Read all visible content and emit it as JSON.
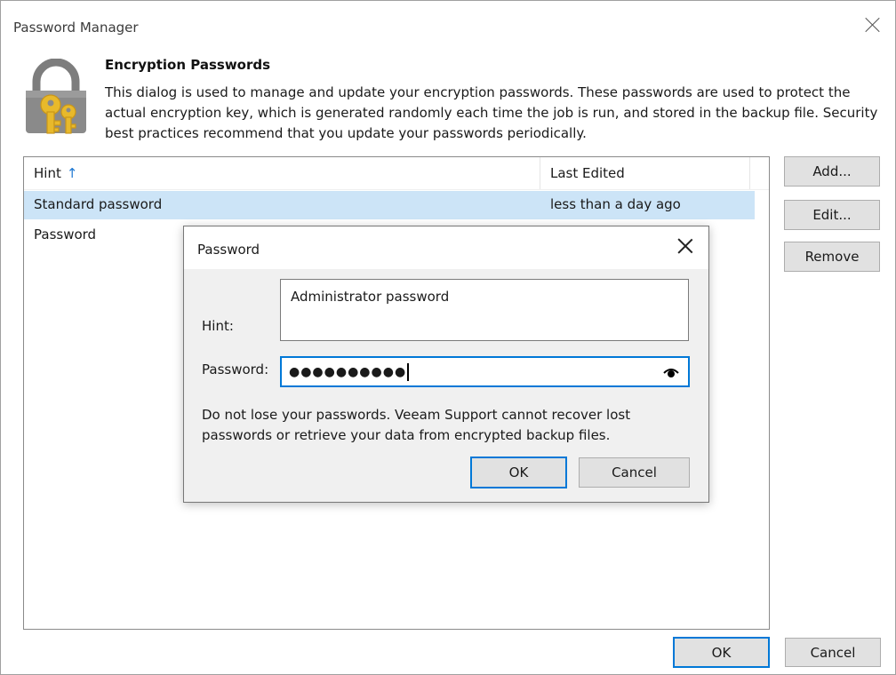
{
  "window": {
    "title": "Password Manager"
  },
  "header": {
    "title": "Encryption Passwords",
    "description": "This dialog is used to manage and update your encryption passwords. These passwords are used to protect the actual encryption key, which is generated randomly each time the job is run, and stored in the backup file. Security best practices recommend that you update your passwords periodically."
  },
  "list": {
    "columns": [
      "Hint",
      "Last Edited"
    ],
    "sort_indicator": "↑",
    "rows": [
      {
        "hint": "Standard password",
        "last_edited": "less than a day ago",
        "selected": true
      },
      {
        "hint": "Password",
        "last_edited": "",
        "selected": false
      }
    ]
  },
  "side_buttons": {
    "add": "Add...",
    "edit": "Edit...",
    "remove": "Remove"
  },
  "footer": {
    "ok": "OK",
    "cancel": "Cancel"
  },
  "password_dialog": {
    "title": "Password",
    "hint_label": "Hint:",
    "hint_value": "Administrator password",
    "password_label": "Password:",
    "password_masked": "●●●●●●●●●●",
    "warning": "Do not lose your passwords. Veeam Support cannot recover lost passwords or retrieve your data from encrypted backup files.",
    "ok": "OK",
    "cancel": "Cancel"
  },
  "icons": {
    "header": "lock-keys-icon",
    "reveal": "eye-icon",
    "close": "close-icon"
  },
  "colors": {
    "accent": "#0078d7",
    "selection": "#cce4f7",
    "sort_arrow": "#1e78d2",
    "key": "#e8b92b",
    "lock": "#7d7d7d"
  }
}
